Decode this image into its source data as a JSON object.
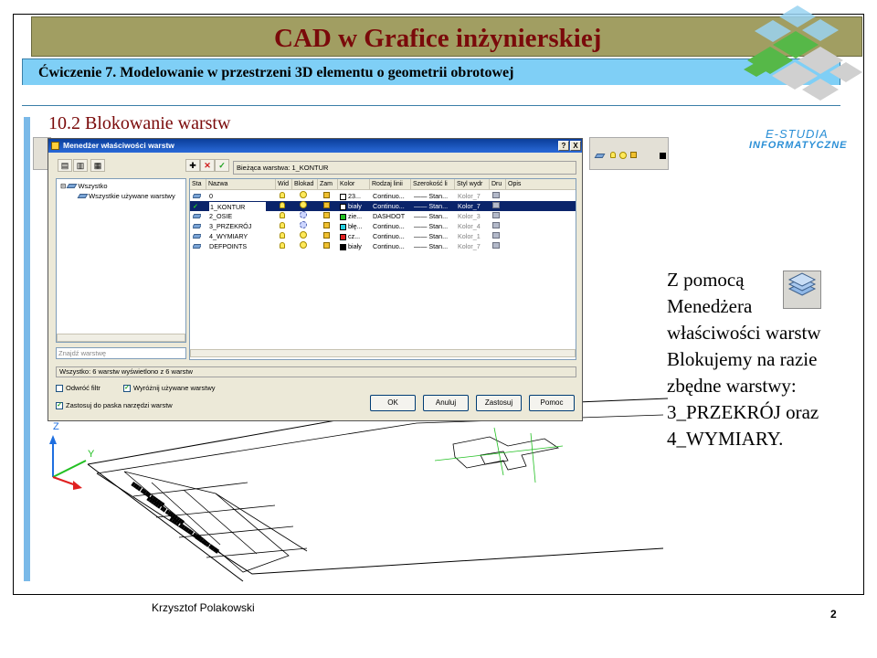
{
  "slide": {
    "title": "CAD w Grafice inżynierskiej",
    "subtitle": "Ćwiczenie 7. Modelowanie w przestrzeni 3D elementu o geometrii obrotowej",
    "section": "10.2 Blokowanie warstw",
    "logo_line1": "E-STUDIA",
    "logo_line2": "INFORMATYCZNE",
    "author": "Krzysztof Polakowski",
    "page": "2",
    "side_text": [
      "Z pomocą",
      "Menedżera",
      "właściwości warstw",
      "Blokujemy na razie",
      "zbędne warstwy:",
      "3_PRZEKRÓJ oraz",
      "4_WYMIARY."
    ]
  },
  "colors": {
    "title_bar": "#a19e62",
    "title_text": "#7a0a0a",
    "subtitle_bar": "#7fcff6",
    "accent_blue": "#2b8fd6"
  },
  "dialog": {
    "title": "Menedżer właściwości warstw",
    "help_btn": "?",
    "close_btn": "X",
    "current_layer": "Bieżąca warstwa: 1_KONTUR",
    "tree": {
      "root": "Wszystko",
      "child": "Wszystkie używane warstwy"
    },
    "search_placeholder": "Znajdź warstwę",
    "columns": [
      "Sta",
      "Nazwa",
      "Wid",
      "Blokad",
      "Zam",
      "Kolor",
      "Rodzaj linii",
      "Szerokość li",
      "Styl wydr",
      "Dru",
      "Opis"
    ],
    "rows": [
      {
        "name": "0",
        "color_name": "23...",
        "color": "#ffffff",
        "linetype": "Continuo...",
        "lineweight": "Stan...",
        "plotstyle": "Kolor_7",
        "frozen": false,
        "selected": false
      },
      {
        "name": "1_KONTUR",
        "color_name": "biały",
        "color": "#ffffff",
        "linetype": "Continuo...",
        "lineweight": "Stan...",
        "plotstyle": "Kolor_7",
        "frozen": false,
        "selected": true
      },
      {
        "name": "2_OSIE",
        "color_name": "zie...",
        "color": "#22c022",
        "linetype": "DASHDOT",
        "lineweight": "Stan...",
        "plotstyle": "Kolor_3",
        "frozen": true,
        "selected": false
      },
      {
        "name": "3_PRZEKRÓJ",
        "color_name": "błę...",
        "color": "#22d0e0",
        "linetype": "Continuo...",
        "lineweight": "Stan...",
        "plotstyle": "Kolor_4",
        "frozen": true,
        "selected": false
      },
      {
        "name": "4_WYMIARY",
        "color_name": "cz...",
        "color": "#e02020",
        "linetype": "Continuo...",
        "lineweight": "Stan...",
        "plotstyle": "Kolor_1",
        "frozen": false,
        "selected": false
      },
      {
        "name": "DEFPOINTS",
        "color_name": "biały",
        "color": "#000000",
        "linetype": "Continuo...",
        "lineweight": "Stan...",
        "plotstyle": "Kolor_7",
        "frozen": false,
        "selected": false
      }
    ],
    "status": "Wszystko: 6 warstw wyświetlono z 6 warstw",
    "check_invert": "Odwróć filtr",
    "check_highlight": "Wyróżnij używane warstwy",
    "check_apply": "Zastosuj do paska narzędzi warstw",
    "btn_ok": "OK",
    "btn_cancel": "Anuluj",
    "btn_apply": "Zastosuj",
    "btn_help": "Pomoc"
  },
  "cad": {
    "axis_z": "Z",
    "axis_y": "Y"
  }
}
